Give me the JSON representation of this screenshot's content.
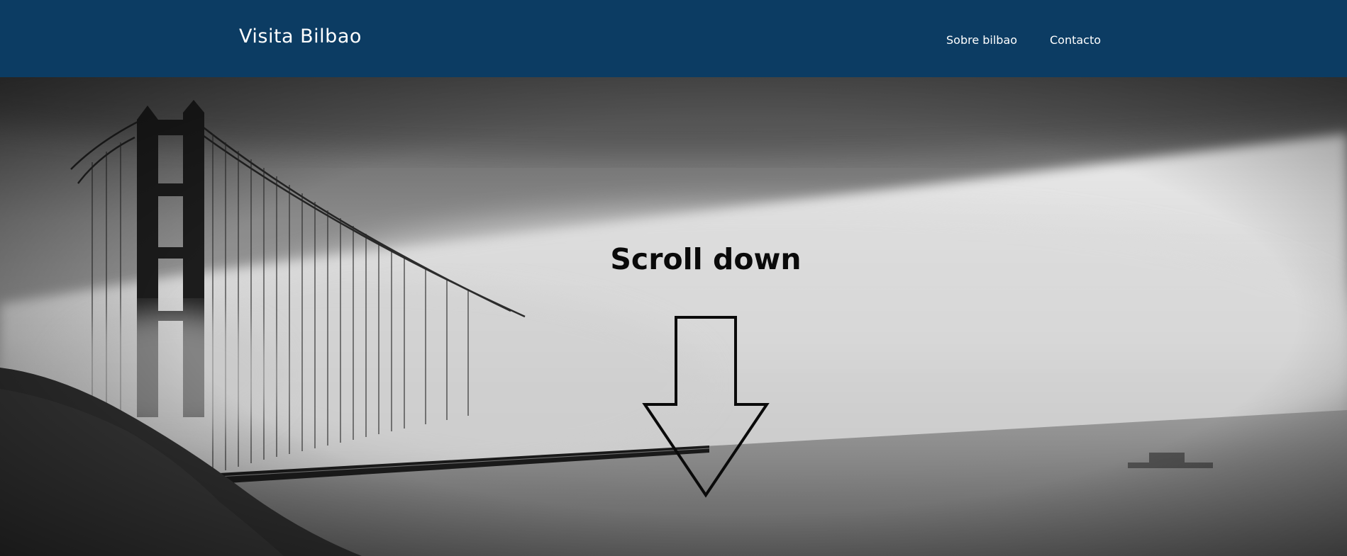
{
  "header": {
    "brand": "Visita Bilbao",
    "nav": [
      {
        "label": "Sobre bilbao"
      },
      {
        "label": "Contacto"
      }
    ]
  },
  "hero": {
    "scroll_text": "Scroll down",
    "arrow_icon": "arrow-down-icon",
    "image": "golden-gate-bridge-in-fog-grayscale"
  },
  "colors": {
    "navbar": "#0c3c63",
    "nav_text": "#ffffff",
    "hero_text": "#0a0a0a"
  }
}
